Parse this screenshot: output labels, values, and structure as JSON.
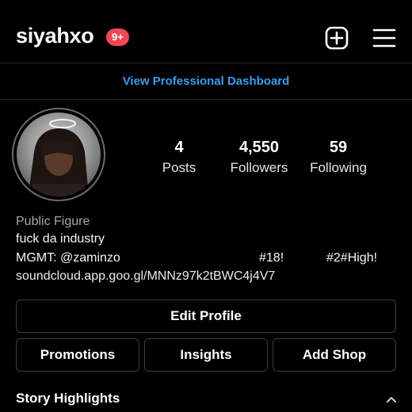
{
  "header": {
    "username": "siyahxo",
    "notification_badge": "9+",
    "new_post_icon": "plus-square-icon",
    "menu_icon": "hamburger-menu-icon"
  },
  "professional_dashboard": {
    "label": "View Professional Dashboard"
  },
  "profile": {
    "stats": [
      {
        "value": "4",
        "label": "Posts"
      },
      {
        "value": "4,550",
        "label": "Followers"
      },
      {
        "value": "59",
        "label": "Following"
      }
    ],
    "category": "Public Figure",
    "bio_line1": "fuck da industry",
    "mgmt": "MGMT: @zaminzo",
    "tag1": "#18!",
    "tag2": "#2#High!",
    "link": "soundcloud.app.goo.gl/MNNz97k2tBWC4j4V7"
  },
  "actions": {
    "edit_profile": "Edit Profile",
    "promotions": "Promotions",
    "insights": "Insights",
    "add_shop": "Add Shop"
  },
  "highlights": {
    "title": "Story Highlights"
  },
  "colors": {
    "background": "#000000",
    "link_blue": "#3b9cf0",
    "badge_red": "#ed4956"
  }
}
